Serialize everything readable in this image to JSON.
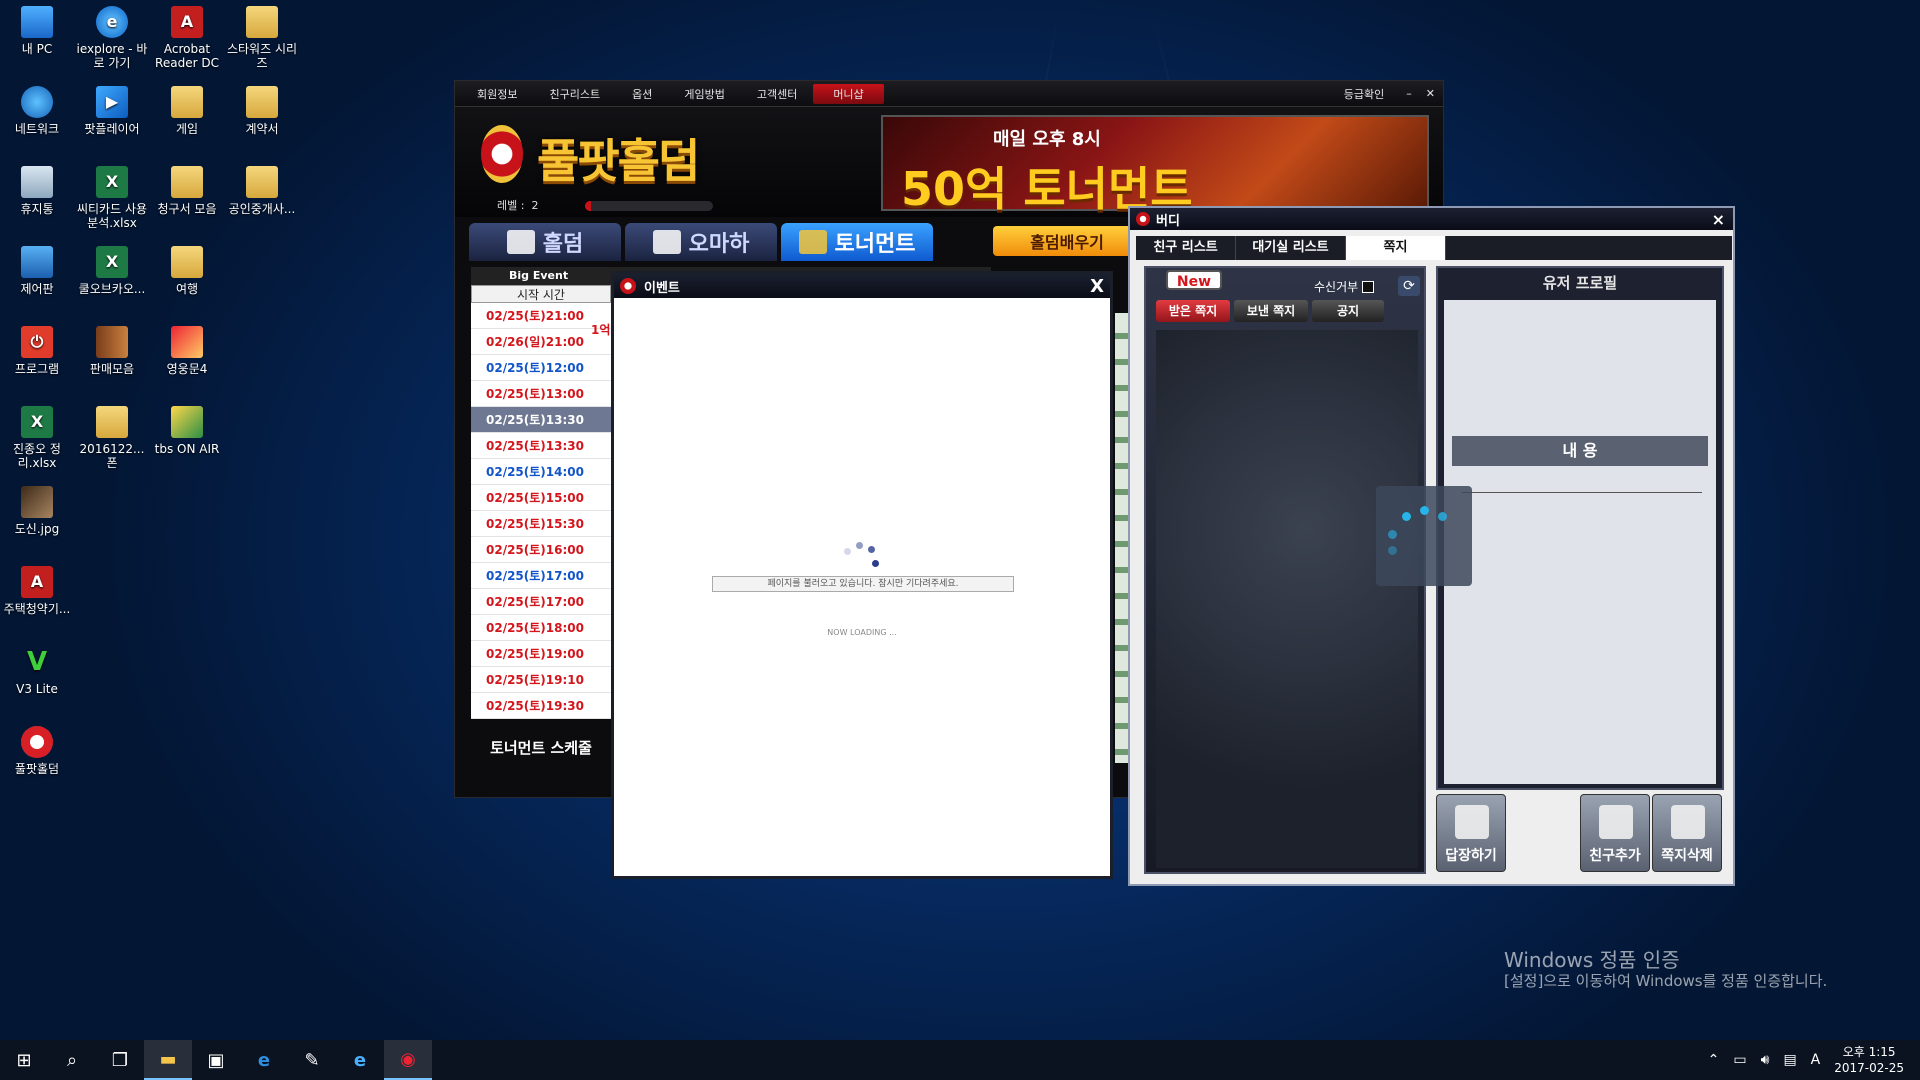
{
  "desktop": {
    "icons": [
      {
        "label": "내 PC",
        "icon": "pc-icon"
      },
      {
        "label": "iexplore - 바로 가기",
        "icon": "ie-icon"
      },
      {
        "label": "Acrobat Reader DC",
        "icon": "pdf-icon"
      },
      {
        "label": "스타워즈 시리즈",
        "icon": "folder-icon"
      },
      {
        "label": "네트워크",
        "icon": "network-icon"
      },
      {
        "label": "팟플레이어",
        "icon": "play-icon"
      },
      {
        "label": "게임",
        "icon": "folder-icon"
      },
      {
        "label": "계약서",
        "icon": "folder-icon"
      },
      {
        "label": "휴지통",
        "icon": "trash-icon"
      },
      {
        "label": "씨티카드 사용분석.xlsx",
        "icon": "excel-icon"
      },
      {
        "label": "청구서 모음",
        "icon": "folder-icon"
      },
      {
        "label": "공인중개사...",
        "icon": "folder-icon"
      },
      {
        "label": "제어판",
        "icon": "control-panel-icon"
      },
      {
        "label": "쿨오브카오...",
        "icon": "excel-icon"
      },
      {
        "label": "여행",
        "icon": "folder-icon"
      },
      {
        "label": "프로그램",
        "icon": "program-icon"
      },
      {
        "label": "판매모음",
        "icon": "book-icon"
      },
      {
        "label": "영웅문4",
        "icon": "game-icon"
      },
      {
        "label": "진종오 정리.xlsx",
        "icon": "excel-icon"
      },
      {
        "label": "2016122... 폰",
        "icon": "folder-icon"
      },
      {
        "label": "tbs ON AIR",
        "icon": "tbs-icon"
      },
      {
        "label": "도신.jpg",
        "icon": "photo-icon"
      },
      {
        "label": "주택청약기...",
        "icon": "pdf-icon"
      },
      {
        "label": "V3 Lite",
        "icon": "v3-icon"
      },
      {
        "label": "풀팟홀덤",
        "icon": "poker-chip-icon"
      }
    ]
  },
  "game": {
    "menu": [
      "회원정보",
      "친구리스트",
      "옵션",
      "게임방법",
      "고객센터",
      "머니샵"
    ],
    "grade_label": "등급확인",
    "min_label": "–",
    "close_label": "✕",
    "logo": "풀팟홀덤",
    "level_label": "레벨 :",
    "level_value": "2",
    "level_progress": 0.05,
    "banner_line1": "매일 오후 8시",
    "banner_line2": "50억 토너먼트",
    "tabs": [
      "홀덤",
      "오마하",
      "토너먼트"
    ],
    "active_tab": "토너먼트",
    "learn_button": "홀덤배우기",
    "big_event": "Big Event",
    "start_time_header": "시작 시간",
    "prize_partial": "1억",
    "schedule": [
      {
        "time": "02/25(토)21:00",
        "color": "red"
      },
      {
        "time": "02/26(일)21:00",
        "color": "red"
      },
      {
        "time": "02/25(토)12:00",
        "color": "blue"
      },
      {
        "time": "02/25(토)13:00",
        "color": "red"
      },
      {
        "time": "02/25(토)13:30",
        "color": "sel"
      },
      {
        "time": "02/25(토)13:30",
        "color": "red"
      },
      {
        "time": "02/25(토)14:00",
        "color": "blue"
      },
      {
        "time": "02/25(토)15:00",
        "color": "red"
      },
      {
        "time": "02/25(토)15:30",
        "color": "red"
      },
      {
        "time": "02/25(토)16:00",
        "color": "red"
      },
      {
        "time": "02/25(토)17:00",
        "color": "blue"
      },
      {
        "time": "02/25(토)17:00",
        "color": "red"
      },
      {
        "time": "02/25(토)18:00",
        "color": "red"
      },
      {
        "time": "02/25(토)19:00",
        "color": "red"
      },
      {
        "time": "02/25(토)19:10",
        "color": "red"
      },
      {
        "time": "02/25(토)19:30",
        "color": "red"
      }
    ],
    "tournament_schedule": "토너먼트 스케줄"
  },
  "event_dialog": {
    "title": "이벤트",
    "close": "X",
    "loading_message": "페이지를 불러오고 있습니다. 잠시만 기다려주세요.",
    "now_loading": "NOW LOADING ..."
  },
  "buddy": {
    "title": "버디",
    "close": "×",
    "tabs": [
      "친구 리스트",
      "대기실 리스트",
      "쪽지"
    ],
    "active_tab": "쪽지",
    "new_badge": "New",
    "reject_label": "수신거부",
    "subtabs": [
      "받은 쪽지",
      "보낸 쪽지",
      "공지"
    ],
    "profile_header": "유저 프로필",
    "content_label": "내 용",
    "buttons": [
      "답장하기",
      "친구추가",
      "쪽지삭제"
    ]
  },
  "watermark": {
    "line1": "Windows 정품 인증",
    "line2": "[설정]으로 이동하여 Windows를 정품 인증합니다."
  },
  "taskbar": {
    "ime": "A",
    "time": "오후 1:15",
    "date": "2017-02-25"
  }
}
